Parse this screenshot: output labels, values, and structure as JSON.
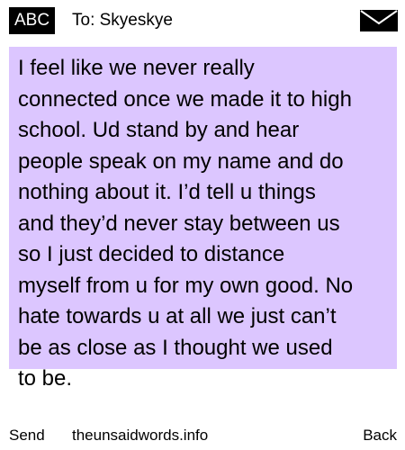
{
  "header": {
    "mode_badge": "ABC",
    "recipient_label": "To: Skyeskye",
    "envelope_icon": "envelope-icon"
  },
  "message": {
    "body": "I feel like we never really\nconnected once we made it to high\nschool. Ud stand by and hear\npeople speak on my name and do\nnothing about it. I’d tell u things\nand they’d never stay between us\nso I just decided to distance\nmyself from u for my own good. No\nhate towards u at all we just can’t\nbe as close as I thought we used\nto be.",
    "highlight_color": "#dcc6ff"
  },
  "softkeys": {
    "left": "Send",
    "center": "theunsaidwords.info",
    "right": "Back"
  }
}
